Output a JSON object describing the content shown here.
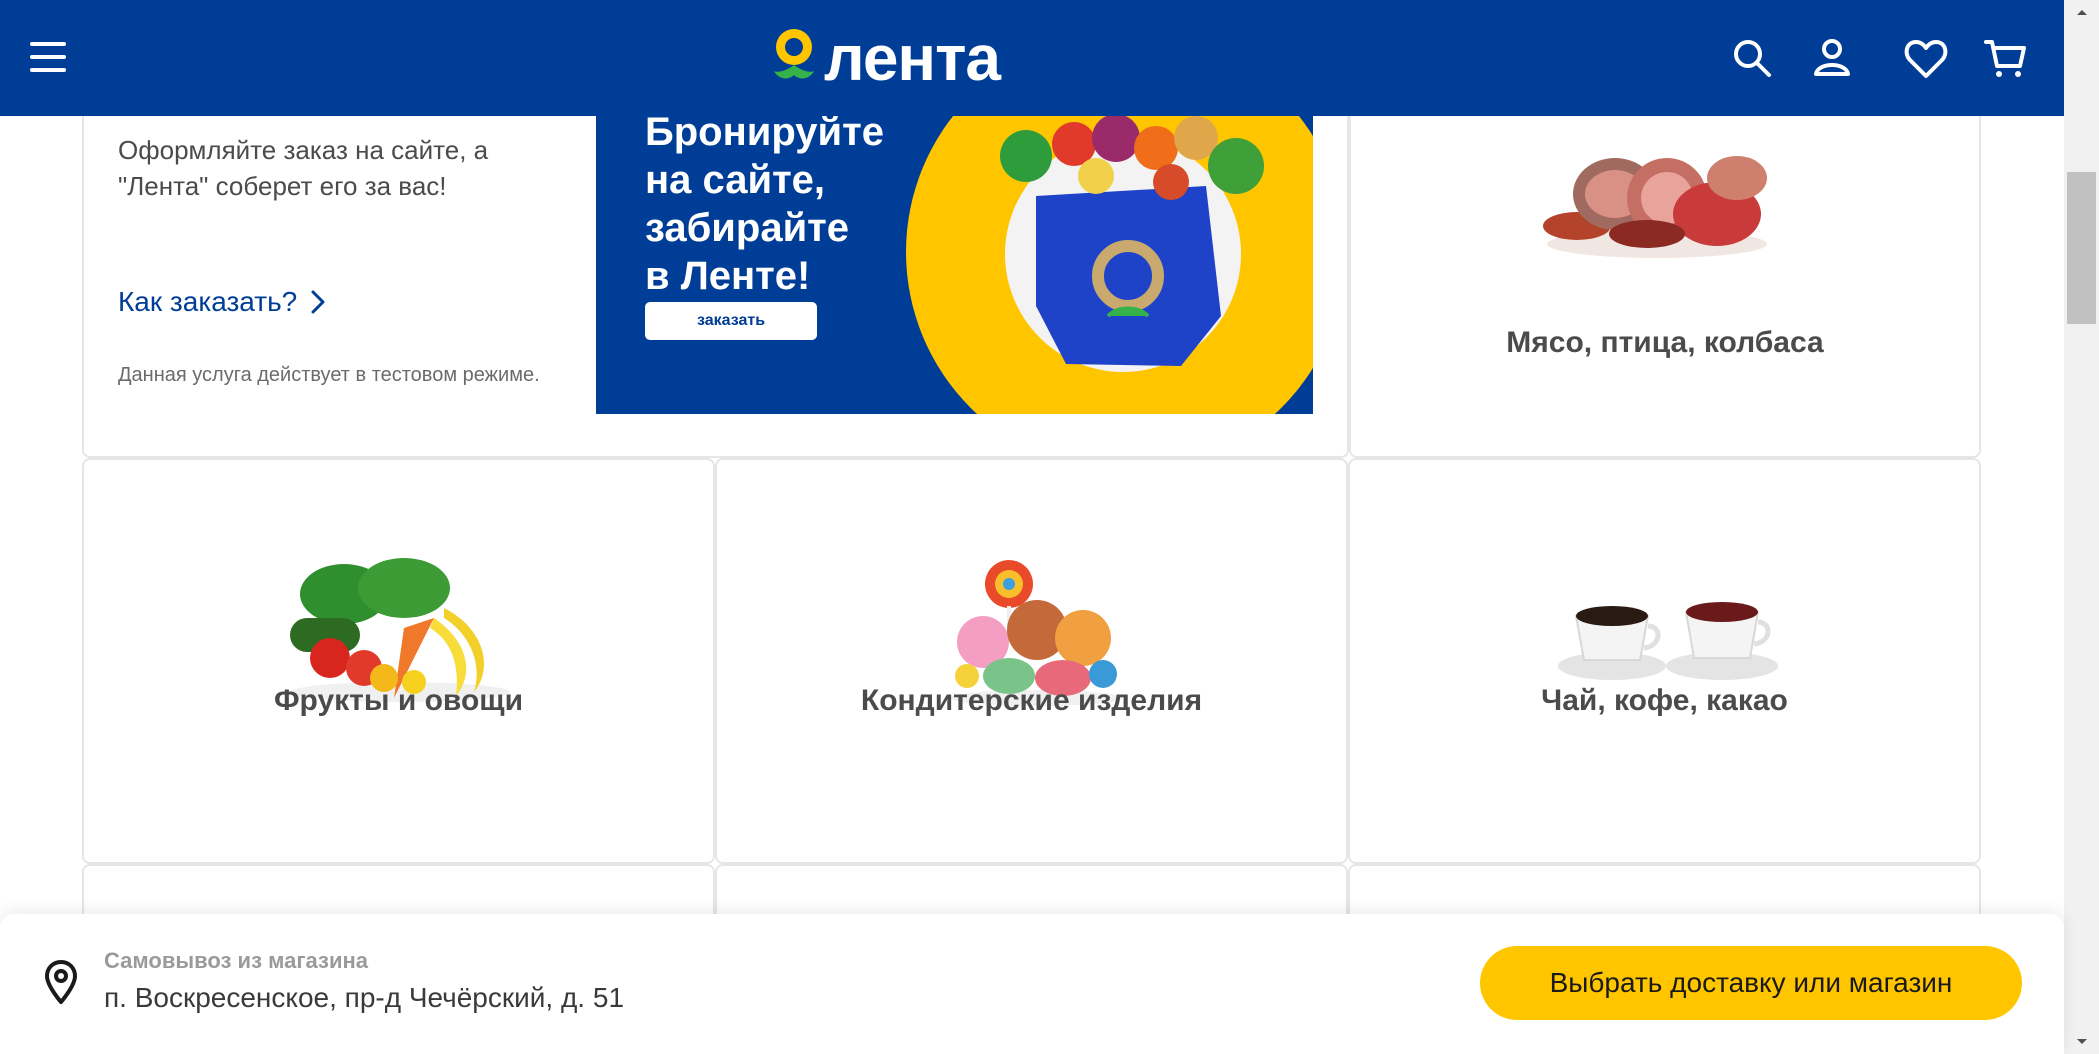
{
  "header": {
    "logo_text": "лента",
    "brand_color": "#003d96",
    "accent_color": "#ffc600",
    "icons": [
      "menu-icon",
      "search-icon",
      "user-icon",
      "heart-icon",
      "cart-icon"
    ]
  },
  "promo": {
    "text": "Оформляйте заказ на сайте, а \"Лента\" соберет его за вас!",
    "link_label": "Как заказать?",
    "note": "Данная услуга действует в тестовом режиме.",
    "banner_lines": [
      "Бронируйте",
      "на сайте,",
      "забирайте",
      "в Ленте!"
    ],
    "banner_button": "заказать"
  },
  "categories": [
    {
      "title": "Мясо, птица, колбаса"
    },
    {
      "title": "Фрукты и овощи"
    },
    {
      "title": "Кондитерские изделия"
    },
    {
      "title": "Чай, кофе, какао"
    }
  ],
  "delivery": {
    "label": "Самовывоз из магазина",
    "address": "п. Воскресенское, пр-д Чечёрский, д. 51",
    "button_label": "Выбрать доставку или магазин"
  }
}
